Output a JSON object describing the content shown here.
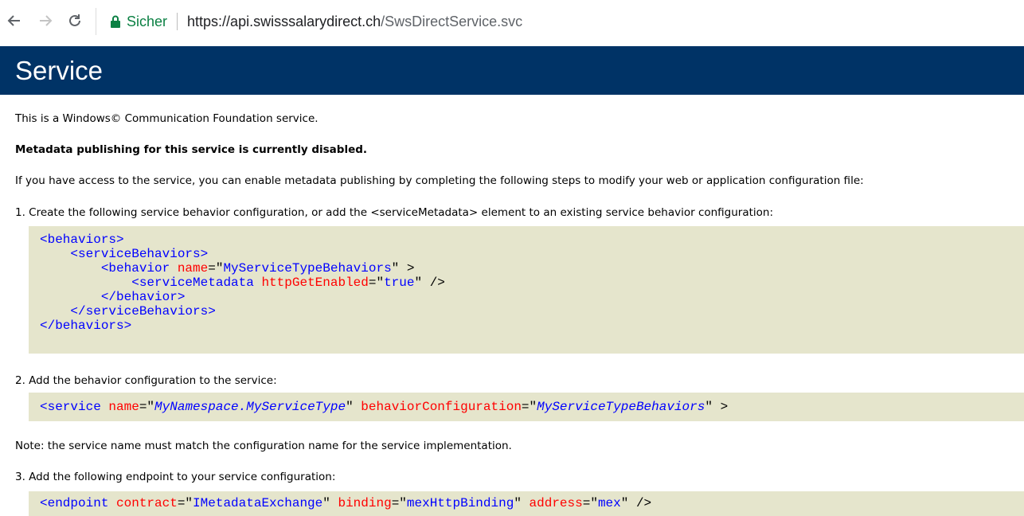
{
  "browser": {
    "secure_label": "Sicher",
    "url_host": "https://api.swisssalarydirect.ch",
    "url_path": "/SwsDirectService.svc"
  },
  "page": {
    "title": "Service",
    "intro": "This is a Windows© Communication Foundation service.",
    "disabled_notice": "Metadata publishing for this service is currently disabled.",
    "access_text": "If you have access to the service, you can enable metadata publishing by completing the following steps to modify your web or application configuration file:",
    "step1": "1. Create the following service behavior configuration, or add the <serviceMetadata> element to an existing service behavior configuration:",
    "step2": "2. Add the behavior configuration to the service:",
    "note": "Note: the service name must match the configuration name for the service implementation.",
    "step3": "3. Add the following endpoint to your service configuration:"
  },
  "code1": {
    "line1": "<behaviors>",
    "line2_tag": "    <serviceBehaviors>",
    "line3_open": "        <behavior ",
    "line3_attr": "name",
    "line3_eq": "=\"",
    "line3_val": "MyServiceTypeBehaviors",
    "line3_close": "\" >",
    "line4_open": "            <serviceMetadata ",
    "line4_attr": "httpGetEnabled",
    "line4_eq": "=\"",
    "line4_val": "true",
    "line4_close": "\" />",
    "line5": "        </behavior>",
    "line6": "    </serviceBehaviors>",
    "line7": "</behaviors>"
  },
  "code2": {
    "open": "<service ",
    "attr1": "name",
    "eq1": "=\"",
    "val1": "MyNamespace.MyServiceType",
    "q1": "\" ",
    "attr2": "behaviorConfiguration",
    "eq2": "=\"",
    "val2": "MyServiceTypeBehaviors",
    "close": "\" >"
  },
  "code3": {
    "open": "<endpoint ",
    "attr1": "contract",
    "eq1": "=\"",
    "val1": "IMetadataExchange",
    "q1": "\" ",
    "attr2": "binding",
    "eq2": "=\"",
    "val2": "mexHttpBinding",
    "q2": "\" ",
    "attr3": "address",
    "eq3": "=\"",
    "val3": "mex",
    "close": "\" />"
  }
}
